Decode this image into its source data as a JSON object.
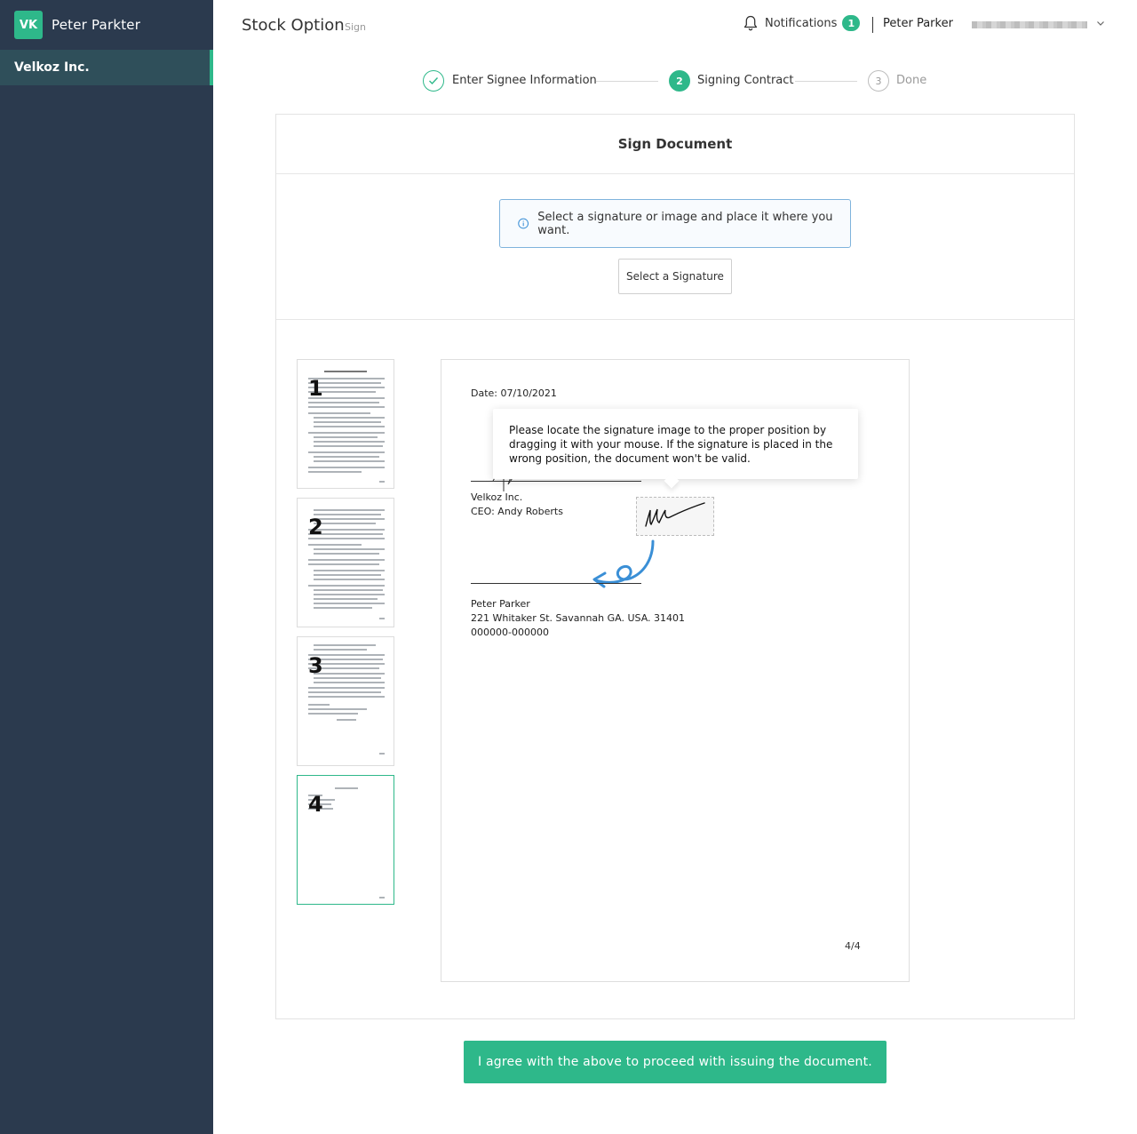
{
  "sidebar": {
    "brand_initials": "VK",
    "brand_name": "Peter Parkter",
    "items": [
      {
        "label": "Velkoz Inc.",
        "active": true
      }
    ]
  },
  "header": {
    "title": "Stock Option",
    "subtitle": "Sign",
    "notifications_label": "Notifications",
    "notifications_count": "1",
    "user_name": "Peter Parker"
  },
  "stepper": {
    "steps": [
      {
        "number": "1",
        "label": "Enter Signee Information",
        "state": "done"
      },
      {
        "number": "2",
        "label": "Signing Contract",
        "state": "active"
      },
      {
        "number": "3",
        "label": "Done",
        "state": "todo"
      }
    ]
  },
  "card": {
    "title": "Sign Document",
    "info_message": "Select a signature or image and place it where you want.",
    "select_signature_label": "Select a Signature"
  },
  "thumbnails": [
    {
      "number": "1"
    },
    {
      "number": "2"
    },
    {
      "number": "3"
    },
    {
      "number": "4",
      "active": true
    }
  ],
  "document": {
    "date_label": "Date:",
    "date_value": "07/10/2021",
    "tooltip": "Please locate the signature image to the proper position by dragging it with your mouse. If the signature is placed in the wrong position, the document won't be valid.",
    "company": "Velkoz Inc.",
    "ceo": "CEO: Andy Roberts",
    "signee_name": "Peter Parker",
    "signee_address": "221 Whitaker St. Savannah GA. USA. 31401",
    "signee_id": "000000-000000",
    "page_indicator": "4/4"
  },
  "agree_button_label": "I agree with the above to proceed with issuing the document.",
  "colors": {
    "sidebar_bg": "#2b3a4e",
    "accent": "#2eb88a",
    "info_border": "#7fb3dc",
    "arrow_blue": "#3a8fd6"
  }
}
